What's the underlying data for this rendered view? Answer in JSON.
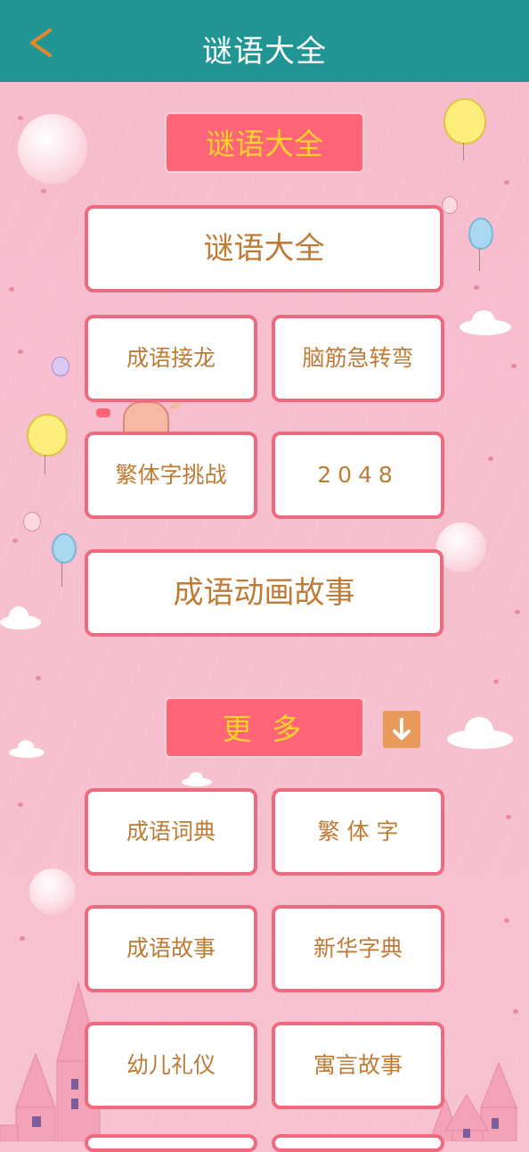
{
  "header": {
    "title": "谜语大全",
    "back_icon": "chevron-left-icon"
  },
  "section1": {
    "label": "谜语大全"
  },
  "main_cards": {
    "riddles": "谜语大全",
    "idiom_chain": "成语接龙",
    "brain_teaser": "脑筋急转弯",
    "traditional_challenge": "繁体字挑战",
    "game_2048": "2048",
    "idiom_animation": "成语动画故事"
  },
  "section2": {
    "label": "更 多",
    "expand_icon": "arrow-down-icon"
  },
  "more_cards": {
    "idiom_dictionary": "成语词典",
    "traditional_chars": "繁 体 字",
    "idiom_stories": "成语故事",
    "xinhua_dictionary": "新华字典",
    "child_etiquette": "幼儿礼仪",
    "fables": "寓言故事"
  },
  "colors": {
    "topbar": "#219494",
    "accent_pink": "#ff6577",
    "label_yellow": "#ffd12b",
    "card_text": "#bf7a35",
    "card_border": "#ee6b7f",
    "background": "#f7c1cf"
  }
}
